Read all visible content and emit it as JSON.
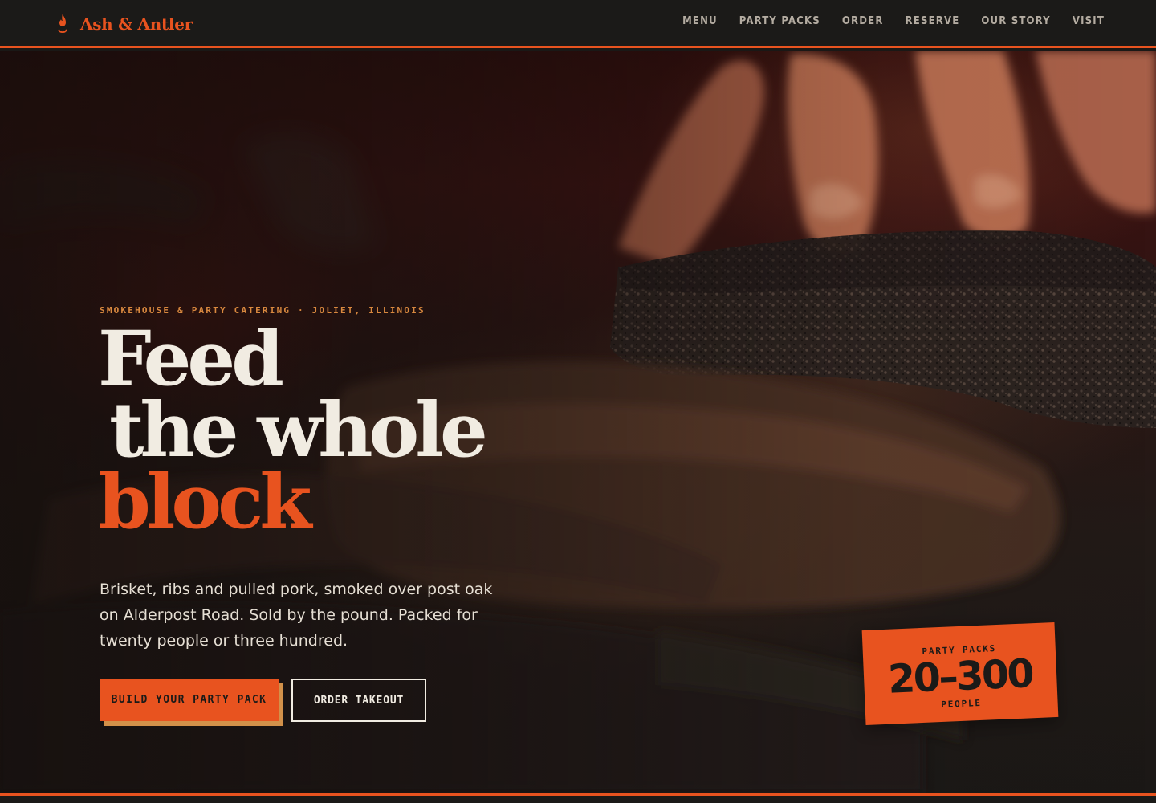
{
  "brand": {
    "name": "Ash & Antler",
    "icon": "flame-icon",
    "accent_color": "#e8531f"
  },
  "nav": {
    "items": [
      {
        "label": "MENU"
      },
      {
        "label": "PARTY PACKS"
      },
      {
        "label": "ORDER"
      },
      {
        "label": "RESERVE"
      },
      {
        "label": "OUR STORY"
      },
      {
        "label": "VISIT"
      }
    ]
  },
  "hero": {
    "eyebrow": "SMOKEHOUSE & PARTY CATERING · JOLIET, ILLINOIS",
    "headline_line1": "Feed",
    "headline_line2": "the whole",
    "headline_accent": "block",
    "lede": "Brisket, ribs and pulled pork, smoked over post oak on Alderpost Road. Sold by the pound. Packed for twenty people or three hundred.",
    "primary_cta": "BUILD YOUR PARTY PACK",
    "secondary_cta": "ORDER TAKEOUT",
    "background_image": "brisket-slab-photo"
  },
  "badge": {
    "label": "PARTY PACKS",
    "range": "20–300",
    "unit": "PEOPLE"
  },
  "colors": {
    "orange": "#e8531f",
    "cream": "#f1ece2",
    "gold": "#d9893f",
    "dark": "#1b1a18"
  }
}
